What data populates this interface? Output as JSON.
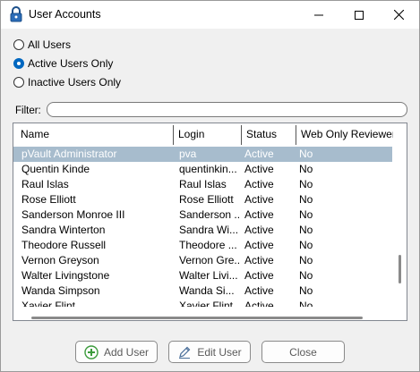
{
  "window": {
    "title": "User Accounts",
    "title_icon": "lock-icon"
  },
  "controls": {
    "minimize": "minimize-icon",
    "maximize": "maximize-icon",
    "close": "close-icon"
  },
  "filters": {
    "options": [
      {
        "label": "All Users",
        "checked": false
      },
      {
        "label": "Active Users Only",
        "checked": true
      },
      {
        "label": "Inactive Users Only",
        "checked": false
      }
    ],
    "filter_label": "Filter:",
    "filter_value": ""
  },
  "table": {
    "columns": [
      "Name",
      "Login",
      "Status",
      "Web Only Reviewer"
    ],
    "rows": [
      {
        "name": "pVault Administrator",
        "login": "pva",
        "status": "Active",
        "reviewer": "No",
        "selected": true
      },
      {
        "name": "Quentin Kinde",
        "login": "quentinkin...",
        "status": "Active",
        "reviewer": "No"
      },
      {
        "name": "Raul Islas",
        "login": "Raul Islas",
        "status": "Active",
        "reviewer": "No"
      },
      {
        "name": "Rose Elliott",
        "login": "Rose Elliott",
        "status": "Active",
        "reviewer": "No"
      },
      {
        "name": "Sanderson Monroe III",
        "login": "Sanderson ...",
        "status": "Active",
        "reviewer": "No"
      },
      {
        "name": "Sandra Winterton",
        "login": "Sandra Wi...",
        "status": "Active",
        "reviewer": "No"
      },
      {
        "name": "Theodore Russell",
        "login": "Theodore ...",
        "status": "Active",
        "reviewer": "No"
      },
      {
        "name": "Vernon Greyson",
        "login": "Vernon Gre...",
        "status": "Active",
        "reviewer": "No"
      },
      {
        "name": "Walter Livingstone",
        "login": "Walter Livi...",
        "status": "Active",
        "reviewer": "No"
      },
      {
        "name": "Wanda Simpson",
        "login": "Wanda Si...",
        "status": "Active",
        "reviewer": "No"
      },
      {
        "name": "Xavier Flint",
        "login": "Xavier Flint",
        "status": "Active",
        "reviewer": "No"
      }
    ]
  },
  "buttons": {
    "add": {
      "label": "Add User",
      "icon": "plus-circle-icon"
    },
    "edit": {
      "label": "Edit User",
      "icon": "pencil-icon"
    },
    "close": {
      "label": "Close"
    }
  },
  "colors": {
    "accent": "#0067c0",
    "selection": "#a7bccd",
    "add_icon": "#3c9b3c"
  }
}
